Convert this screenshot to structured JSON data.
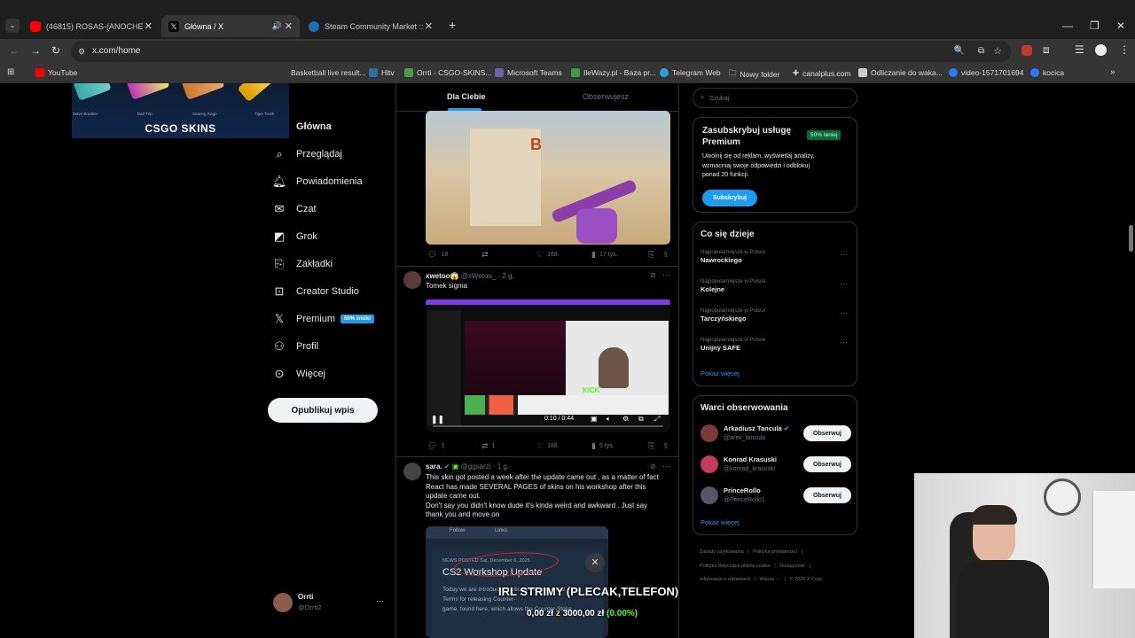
{
  "tabs": [
    {
      "title": "(46815) ROSAS-(ANOCHE)(VIDE",
      "favicon_color": "#ff0000"
    },
    {
      "title": "Główna / X",
      "favicon_color": "#000000"
    },
    {
      "title": "Steam Community Market :: List",
      "favicon_color": "#1b2838"
    }
  ],
  "new_tab_label": "+",
  "address": {
    "url": "x.com/home"
  },
  "bookmarks": [
    "YouTube",
    "Basketball live result...",
    "Hltv",
    "Orrti - CSGO-SKINS...",
    "Microsoft Teams",
    "IleWazy.pl - Baza pr...",
    "Telegram Web",
    "Nowy folder",
    "canalplus.com",
    "Odliczanie do waka...",
    "video-1571701694",
    "kocica"
  ],
  "overlay_banner": {
    "brand": "CSGO SKINS",
    "skins": [
      "Wave Breaker",
      "Bad Trip",
      "Searing Rage",
      "Tiger Tooth"
    ]
  },
  "nav": {
    "items": [
      {
        "label": "Główna",
        "icon": "home-icon"
      },
      {
        "label": "Przeglądaj",
        "icon": "search-icon"
      },
      {
        "label": "Powiadomienia",
        "icon": "bell-icon"
      },
      {
        "label": "Czat",
        "icon": "mail-icon"
      },
      {
        "label": "Grok",
        "icon": "grok-icon"
      },
      {
        "label": "Zakładki",
        "icon": "bookmark-icon"
      },
      {
        "label": "Creator Studio",
        "icon": "creator-icon"
      },
      {
        "label": "Premium",
        "icon": "x-logo-icon",
        "badge": "50% zniżki"
      },
      {
        "label": "Profil",
        "icon": "person-icon"
      },
      {
        "label": "Więcej",
        "icon": "more-icon"
      }
    ],
    "post_button": "Opublikuj wpis",
    "account": {
      "name": "Orrti",
      "handle": "@Orrti2"
    }
  },
  "feed": {
    "tabs": [
      "Dla Ciebie",
      "Obserwujesz"
    ],
    "tweet1": {
      "replies": "18",
      "likes": "168",
      "views": "17 tys."
    },
    "tweet2": {
      "name": "xwetoo😱",
      "handle": "@xWetoo_",
      "time": "· 2 g.",
      "text": "Tomek sigma",
      "video_time": "0:10 / 0:44",
      "replies": "1",
      "reposts": "1",
      "likes": "188",
      "views": "5 tys."
    },
    "tweet3": {
      "name": "sara.",
      "handle": "@ggsarzi",
      "time": "· 1 g.",
      "lines": [
        "This skin got posted a week after the update came out , as a matter of fact",
        "React has made SEVERAL PAGES of skins on his workshop after this",
        "update came out.",
        "Don't say you didn't know dude it's kinda weird and awkward . Just say",
        "thank you and move on"
      ],
      "embed": {
        "follow": "Follow",
        "links": "Links",
        "posted": "NEWS POSTED Sat, December 6, 2025",
        "title": "CS2 Workshop Update",
        "body1": "Today we are introducing optional Supplemental",
        "body2": "Terms for releasing Counter-",
        "body3": "game, found here, which allows the Counter-Strike"
      }
    }
  },
  "sidebar": {
    "search_placeholder": "Szukaj",
    "premium": {
      "title1": "Zasubskrybuj usługę",
      "title2": "Premium",
      "badge": "50% taniej",
      "lines": [
        "Uwolnij się od reklam, wyświetlaj analizy,",
        "wzmacniaj swoje odpowiedzi i odblokuj",
        "ponad 20 funkcji."
      ],
      "button": "Subskrybuj"
    },
    "trends": {
      "title": "Co się dzieje",
      "items": [
        {
          "context": "Najpopularniejsze w Polsce",
          "name": "Nawrockiego"
        },
        {
          "context": "Najpopularniejsze w Polsce",
          "name": "Kolejne"
        },
        {
          "context": "Najpopularniejsze w Polsce",
          "name": "Tarczyńskiego"
        },
        {
          "context": "Najpopularniejsze w Polsce",
          "name": "Unijny SAFE"
        }
      ],
      "more": "Pokaż więcej"
    },
    "who_to_follow": {
      "title": "Warci obserwowania",
      "items": [
        {
          "name": "Arkadiusz Tancula",
          "handle": "@arek_tancula"
        },
        {
          "name": "Konrad Krasuski",
          "handle": "@konrad_krasuski"
        },
        {
          "name": "PrinceRollo",
          "handle": "@PrinceRollo1"
        }
      ],
      "follow_label": "Obserwuj",
      "more": "Pokaż więcej"
    },
    "footer": [
      "Zasady użytkowania",
      "Polityka prywatności",
      "Polityka dotycząca plików cookie",
      "Dostępność",
      "Informacje o reklamach",
      "Więcej ···",
      "© 2026 X Corp."
    ]
  },
  "stream_overlay": {
    "title": "IRL STRIMY (PLECAK,TELEFON)",
    "current": "0,00 zł",
    "sep": "z",
    "goal": "3000,00 zł",
    "pct": "(0.00%)"
  }
}
